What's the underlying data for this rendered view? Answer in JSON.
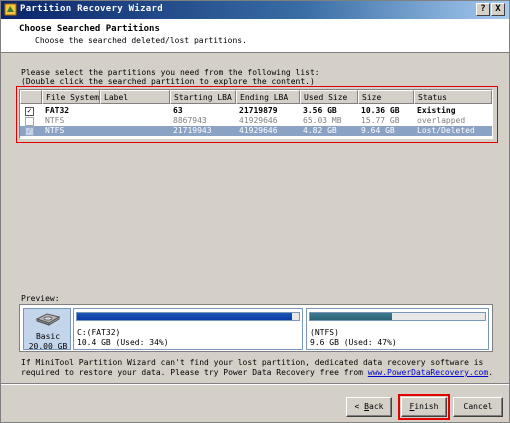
{
  "window": {
    "title": "Partition Recovery Wizard"
  },
  "titlebar_buttons": {
    "help": "?",
    "close": "X"
  },
  "header": {
    "title": "Choose Searched Partitions",
    "subtitle": "Choose the searched deleted/lost partitions."
  },
  "instructions": {
    "line1": "Please select the partitions you need from the following list:",
    "line2": "(Double click the searched partition to explore the content.)"
  },
  "table": {
    "columns": [
      "File System",
      "Label",
      "Starting LBA",
      "Ending LBA",
      "Used Size",
      "Size",
      "Status"
    ],
    "rows": [
      {
        "checked": true,
        "file_system": "FAT32",
        "label": "",
        "starting_lba": "63",
        "ending_lba": "21719879",
        "used_size": "3.56 GB",
        "size": "10.36 GB",
        "status": "Existing",
        "style": "bold"
      },
      {
        "checked": false,
        "file_system": "NTFS",
        "label": "",
        "starting_lba": "8867943",
        "ending_lba": "41929646",
        "used_size": "65.03 MB",
        "size": "15.77 GB",
        "status": "overlapped",
        "style": "grey"
      },
      {
        "checked": true,
        "file_system": "NTFS",
        "label": "",
        "starting_lba": "21719943",
        "ending_lba": "41929646",
        "used_size": "4.82 GB",
        "size": "9.64 GB",
        "status": "Lost/Deleted",
        "style": "selected"
      }
    ]
  },
  "preview": {
    "label": "Preview:",
    "disk": {
      "type": "Basic",
      "size": "20.00 GB",
      "icon": "hard-disk-icon"
    },
    "partitions": [
      {
        "name": "C:(FAT32)",
        "info": "10.4 GB (Used: 34%)",
        "used_fraction": 0.97
      },
      {
        "name": "(NTFS)",
        "info": "9.6 GB (Used: 47%)",
        "used_fraction": 0.47
      }
    ]
  },
  "note": {
    "text_before": "If MiniTool Partition Wizard can't find your lost partition, dedicated data recovery software is required to restore your data. Please try Power Data Recovery free from ",
    "link": "www.PowerDataRecovery.com",
    "text_after": "."
  },
  "buttons": {
    "back_mnemonic": "B",
    "back_rest": "ack",
    "back_prefix": "< ",
    "finish_mnemonic": "F",
    "finish_rest": "inish",
    "cancel": "Cancel"
  },
  "colors": {
    "title_gradient_start": "#0a246a",
    "selection": "#8aa2c4",
    "highlight_box": "#e00000",
    "link": "#0000cc"
  }
}
